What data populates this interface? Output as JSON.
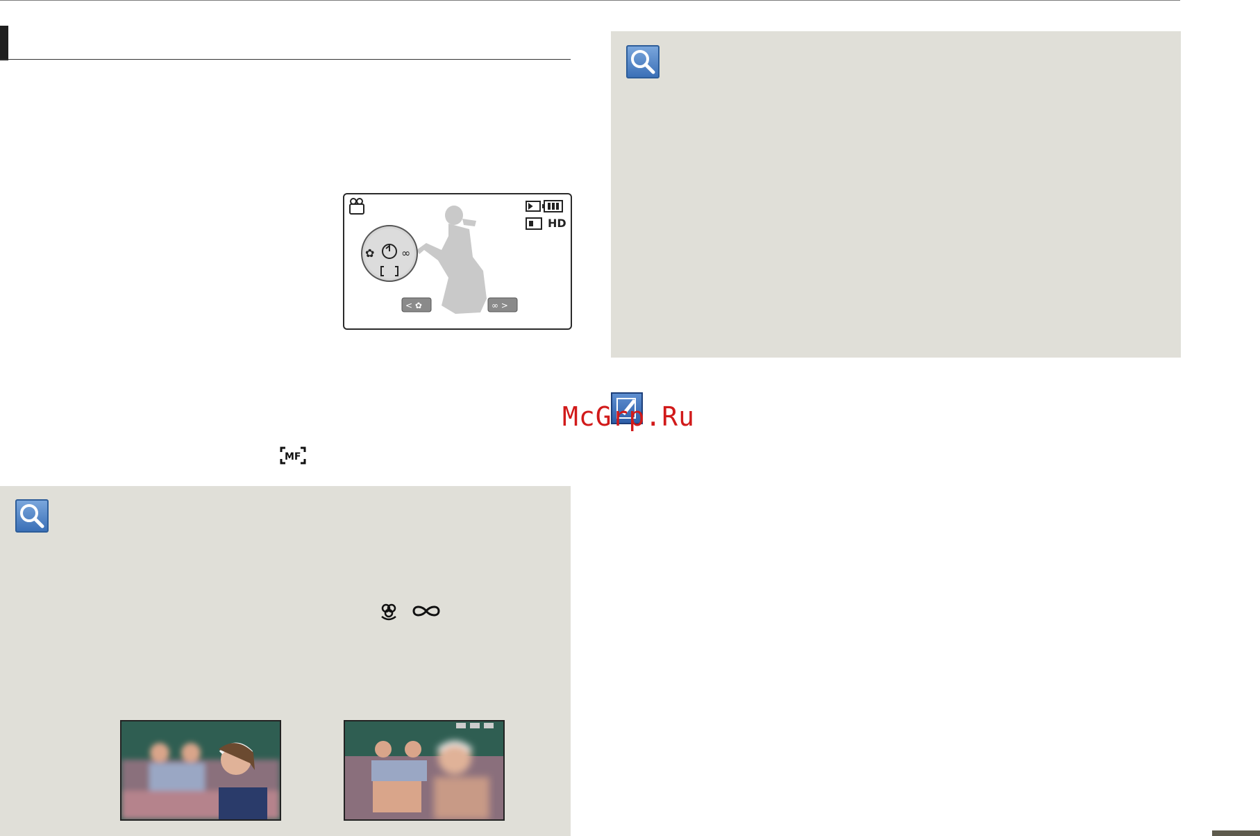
{
  "watermark": {
    "text": "McGrp.Ru"
  },
  "lcd": {
    "left_button_label": "< ✿",
    "right_button_label": "∞ >",
    "quality_label": "HD"
  },
  "icons": {
    "magnifier": "magnifier-icon",
    "note": "note-pencil-icon",
    "manual_focus": "mf-icon",
    "macro": "flower-icon",
    "infinity": "infinity-icon",
    "camcorder": "camcorder-icon",
    "battery": "battery-icon",
    "memory_card": "memory-card-icon"
  },
  "colors": {
    "tip_box_bg": "#e0dfd8",
    "icon_blue": "#3b70b7",
    "watermark_red": "#d11a1a"
  }
}
